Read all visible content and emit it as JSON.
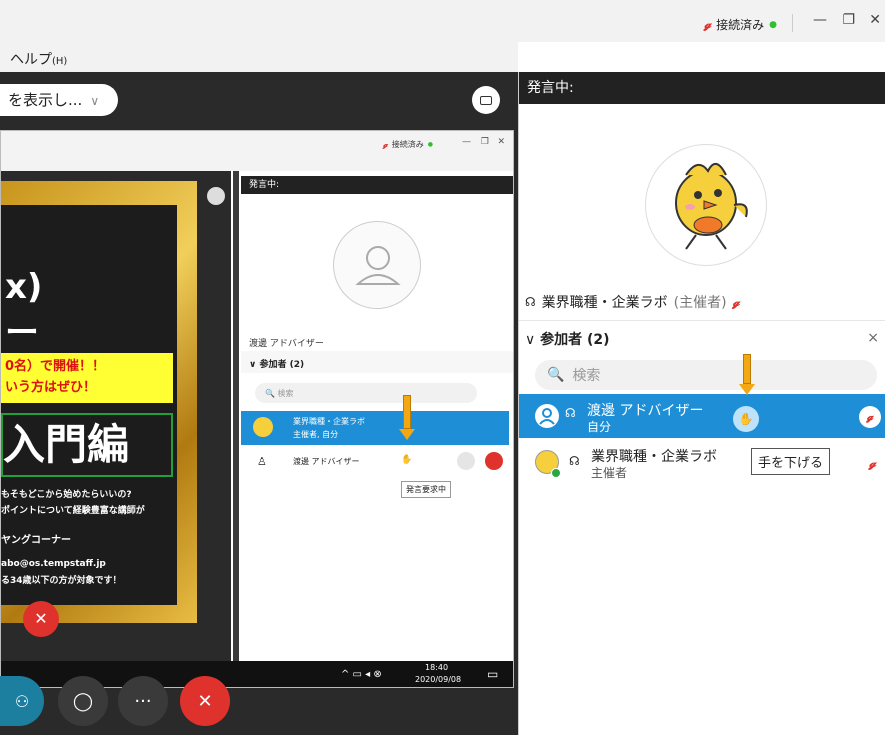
{
  "window": {
    "status_text": "接続済み",
    "minimize": "—",
    "restore": "❐",
    "close": "✕"
  },
  "menu": {
    "help": "ヘルプ",
    "help_key": "(H)"
  },
  "view_pill": {
    "label": "を表示し...",
    "chevron": "∨"
  },
  "inner": {
    "status_text": "接続済み",
    "speaking_label": "発言中:",
    "speaker_name": "渡邊 アドバイザー",
    "participants_label": "参加者 (2)",
    "search_placeholder": "検索",
    "rows": [
      {
        "name": "業界職種・企業ラボ",
        "sub": "主催者, 自分"
      },
      {
        "name": "渡邊 アドバイザー",
        "sub": ""
      }
    ],
    "tooltip": "発言要求中",
    "clock_time": "18:40",
    "clock_date": "2020/09/08",
    "poster": {
      "line1": "x)",
      "line2": "ー",
      "yellow1": "0名）で開催！！",
      "yellow2": "いう方はぜひ！",
      "green": "入門編",
      "small1": "もそもどこから始めたらいいの?",
      "small2": "ポイントについて経験豊富な講師が",
      "small3": "ヤングコーナー",
      "small4": "abo@os.tempstaff.jp",
      "small5": "る34歳以下の方が対象です！"
    }
  },
  "right": {
    "speaking_label": "発言中:",
    "speaker_name": "業界職種・企業ラボ",
    "speaker_role": "(主催者)",
    "participants_label": "参加者 (2)",
    "close": "×",
    "search_placeholder": "検索",
    "participants": [
      {
        "name": "渡邊 アドバイザー",
        "sub": "自分"
      },
      {
        "name": "業界職種・企業ラボ",
        "sub": "主催者"
      }
    ],
    "tooltip": "手を下げる"
  },
  "controls": {
    "more": "···",
    "end": "✕"
  },
  "colors": {
    "accent": "#1e8fd6",
    "end_red": "#e0322d",
    "arrow": "#f3a712",
    "status_green": "#2fbf2f"
  }
}
